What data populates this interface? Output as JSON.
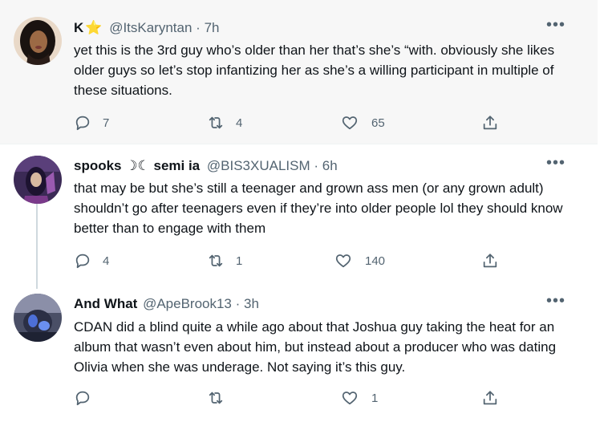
{
  "tweets": [
    {
      "name": "K",
      "name_emoji": "⭐",
      "handle": "@ItsKaryntan",
      "time": "7h",
      "text": "yet this is the 3rd guy who’s older than her that’s she’s “with. obviously she likes older guys so let’s stop infantizing her as she’s a willing participant in multiple of these situations.",
      "replies": "7",
      "retweets": "4",
      "likes": "65"
    },
    {
      "name": "spooks",
      "name_emoji": "☽☾",
      "name_suffix": "semi ia",
      "handle": "@BIS3XUALISM",
      "time": "6h",
      "text": "that may be but she’s still a teenager and grown ass men (or any grown adult) shouldn’t go after teenagers even if they’re into older people lol they should know better than to engage with them",
      "replies": "4",
      "retweets": "1",
      "likes": "140"
    },
    {
      "name": "And What",
      "handle": "@ApeBrook13",
      "time": "3h",
      "text": "CDAN did a blind quite a while ago about that Joshua guy taking the heat for an album that wasn’t even about him, but instead about a producer who was dating Olivia when she was underage. Not saying it’s this guy.",
      "replies": "",
      "retweets": "",
      "likes": "1"
    }
  ],
  "separator": "·",
  "more_glyph": "•••",
  "colors": {
    "highlight_bg": "#f7f7f7",
    "secondary_text": "#536471",
    "thread_line": "#cfd9de"
  }
}
